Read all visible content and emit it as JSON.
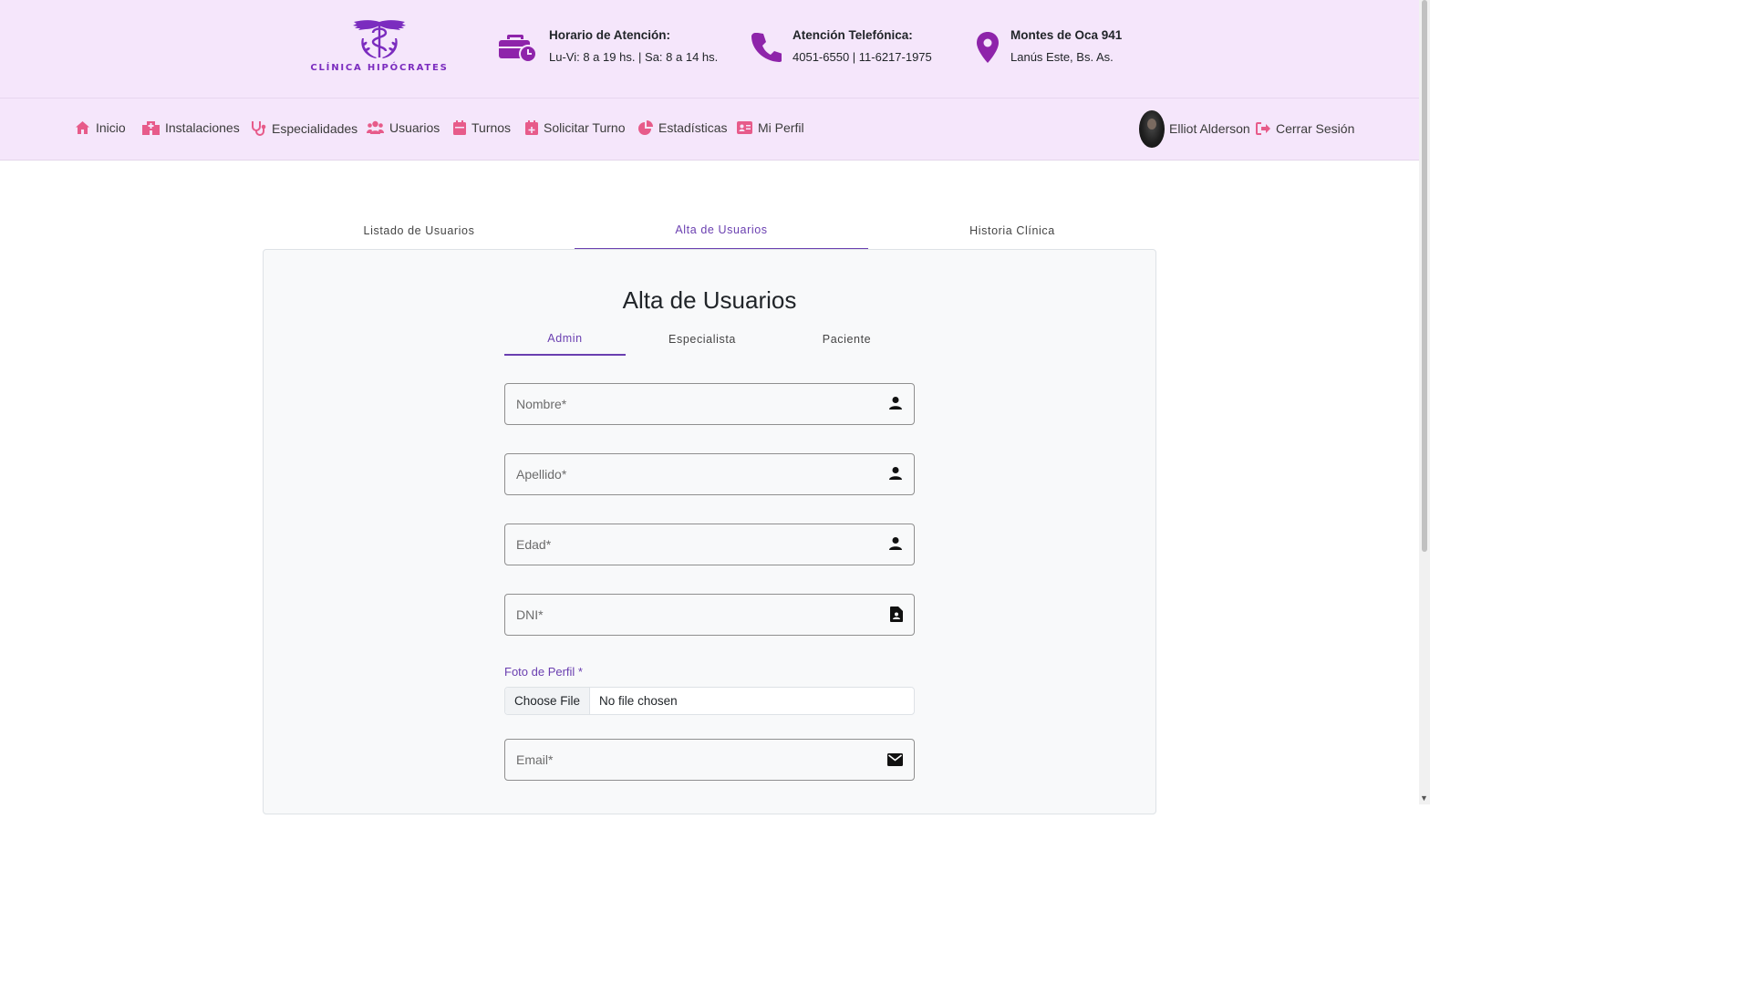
{
  "header": {
    "logo": {
      "brand_text": "CLÍNICA HIPÓCRATES",
      "icon": "caduceus-logo-icon",
      "color": "#7b2cbf"
    },
    "info": [
      {
        "icon": "briefcase-clock-icon",
        "title": "Horario de Atención:",
        "text": "Lu-Vi: 8 a 19 hs. | Sa: 8 a 14 hs."
      },
      {
        "icon": "phone-icon",
        "title": "Atención Telefónica:",
        "text": "4051-6550 | 11-6217-1975"
      },
      {
        "icon": "location-pin-icon",
        "title": "Montes de Oca 941",
        "text": "Lanús Este, Bs. As."
      }
    ]
  },
  "nav": {
    "items": [
      {
        "label": "Inicio",
        "icon": "home-icon"
      },
      {
        "label": "Instalaciones",
        "icon": "hospital-icon"
      },
      {
        "label": "Especialidades",
        "icon": "stethoscope-icon"
      },
      {
        "label": "Usuarios",
        "icon": "users-icon"
      },
      {
        "label": "Turnos",
        "icon": "calendar-icon"
      },
      {
        "label": "Solicitar Turno",
        "icon": "calendar-plus-icon"
      },
      {
        "label": "Estadísticas",
        "icon": "pie-chart-icon"
      },
      {
        "label": "Mi Perfil",
        "icon": "id-card-icon"
      }
    ],
    "user_name": "Elliot Alderson",
    "logout_label": "Cerrar Sesión",
    "icon_color": "#e75b8a"
  },
  "tabs": {
    "items": [
      "Listado de Usuarios",
      "Alta de Usuarios",
      "Historia Clínica"
    ],
    "active": "Alta de Usuarios"
  },
  "form": {
    "title": "Alta de Usuarios",
    "role_tabs": [
      "Admin",
      "Especialista",
      "Paciente"
    ],
    "active_role": "Admin",
    "fields": {
      "nombre": {
        "placeholder": "Nombre*",
        "icon": "person-icon"
      },
      "apellido": {
        "placeholder": "Apellido*",
        "icon": "person-icon"
      },
      "edad": {
        "placeholder": "Edad*",
        "icon": "person-icon"
      },
      "dni": {
        "placeholder": "DNI*",
        "icon": "id-document-icon"
      },
      "email": {
        "placeholder": "Email*",
        "icon": "mail-icon"
      }
    },
    "photo": {
      "label": "Foto de Perfil *",
      "button": "Choose File",
      "status": "No file chosen"
    }
  },
  "colors": {
    "accent": "#6a3fb0",
    "header_bg": "#f5e6fb"
  }
}
